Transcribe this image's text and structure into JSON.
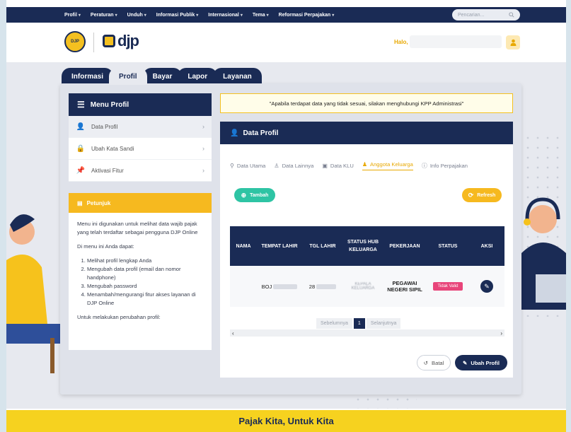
{
  "topnav": {
    "items": [
      "Profil",
      "Peraturan",
      "Unduh",
      "Informasi Publik",
      "Internasional",
      "Tema",
      "Reformasi Perpajakan"
    ],
    "search_placeholder": "Pencarian..."
  },
  "header": {
    "logo_text": "djp",
    "greeting": "Halo,"
  },
  "tabs": [
    "Informasi",
    "Profil",
    "Bayar",
    "Lapor",
    "Layanan"
  ],
  "menu": {
    "title": "Menu Profil",
    "items": [
      {
        "label": "Data Profil",
        "icon": "user-icon"
      },
      {
        "label": "Ubah Kata Sandi",
        "icon": "lock-icon"
      },
      {
        "label": "Aktivasi Fitur",
        "icon": "pin-icon"
      }
    ]
  },
  "guide": {
    "title": "Petunjuk",
    "para1": "Menu ini digunakan untuk melihat data wajib pajak yang telah terdaftar sebagai pengguna DJP Online",
    "para2": "Di menu ini Anda dapat:",
    "list": [
      "Melihat profil lengkap Anda",
      "Mengubah data profil (email dan nomor handphone)",
      "Mengubah password",
      "Menambah/mengurangi fitur akses layanan di DJP Online"
    ],
    "para3": "Untuk melakukan perubahan profil:"
  },
  "notice": "\"Apabila terdapat data yang tidak sesuai, silakan menghubungi KPP Administrasi\"",
  "card": {
    "title": "Data Profil",
    "subtabs": [
      "Data Utama",
      "Data Lainnya",
      "Data KLU",
      "Anggota Keluarga",
      "Info Perpajakan"
    ],
    "add_label": "Tambah",
    "refresh_label": "Refresh",
    "columns": [
      "NAMA",
      "TEMPAT LAHIR",
      "TGL LAHIR",
      "STATUS HUB KELUARGA",
      "PEKERJAAN",
      "STATUS",
      "AKSI"
    ],
    "row": {
      "place_prefix": "BOJ",
      "date_prefix": "28",
      "relation": "KEPALA KELUARGA",
      "job": "PEGAWAI NEGERI SIPIL",
      "status": "Tidak Valid"
    },
    "pager": {
      "prev": "Sebelumnya",
      "current": "1",
      "next": "Selanjutnya"
    },
    "cancel_label": "Batal",
    "save_label": "Ubah Profil"
  },
  "footer": "Pajak Kita, Untuk Kita",
  "colors": {
    "navy": "#1a2b55",
    "yellow": "#f6b91f",
    "teal": "#2ec4a4",
    "pink": "#e8457a"
  }
}
